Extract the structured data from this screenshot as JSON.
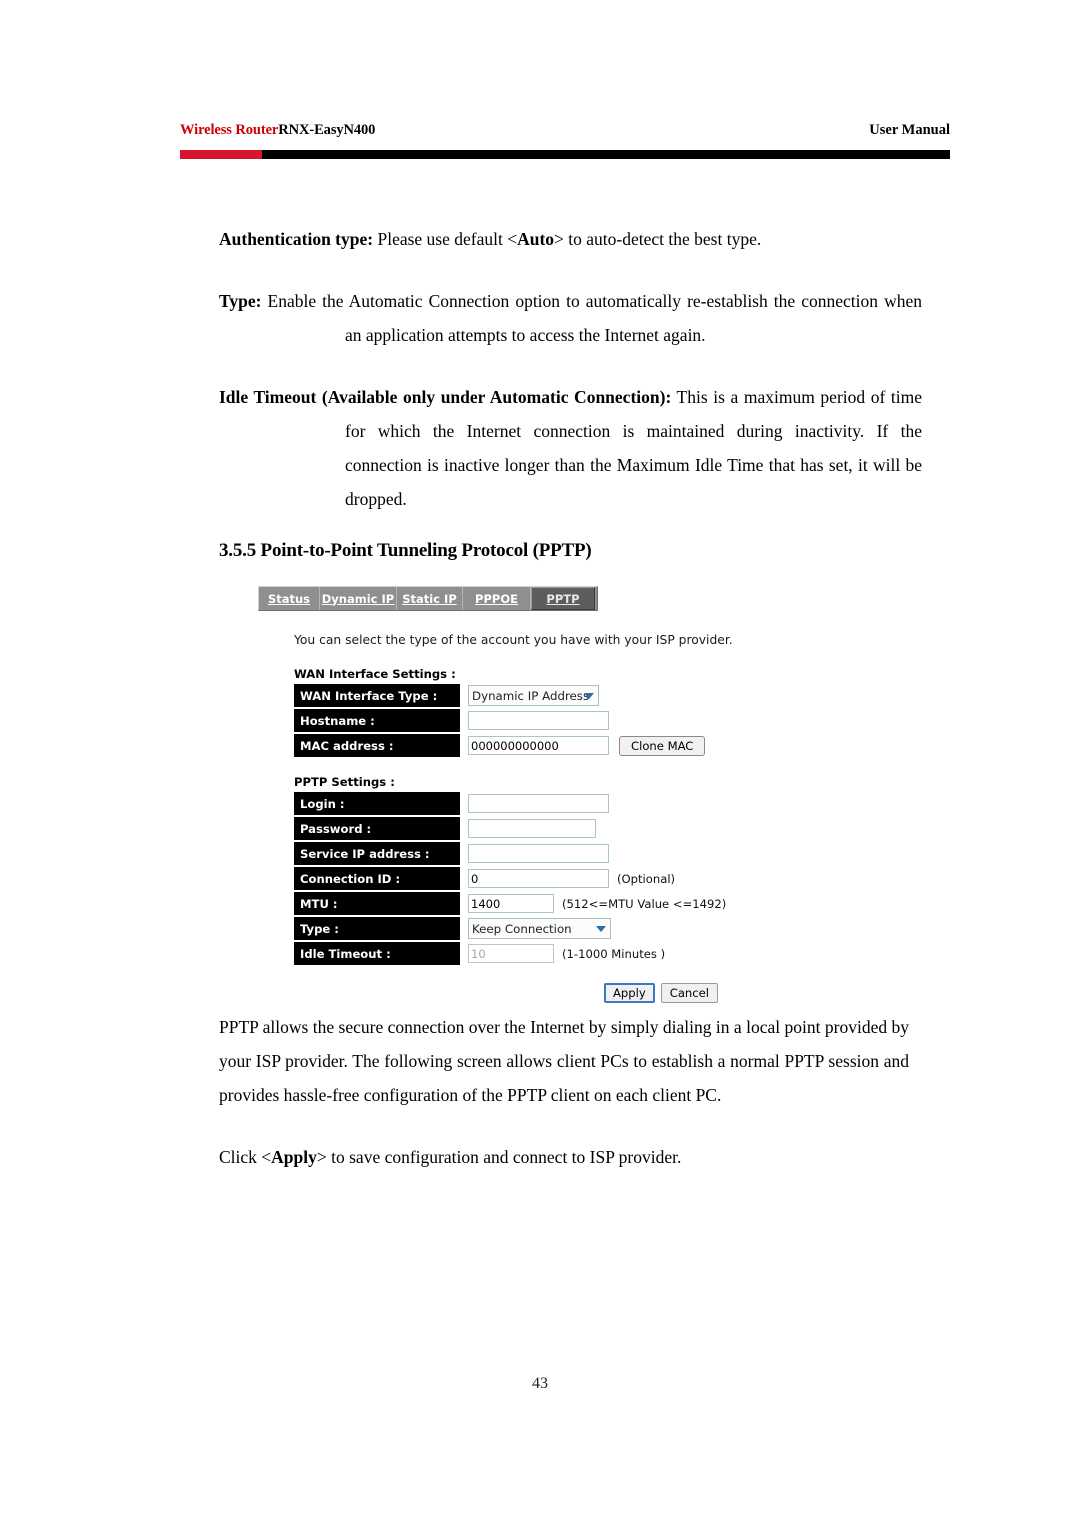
{
  "header": {
    "brand": "Wireless Router",
    "model": "RNX-EasyN400",
    "doc_type": "User Manual",
    "rule_red": "#d6142f",
    "rule_black": "#000000"
  },
  "body": {
    "para_auth_label": "Authentication type:",
    "para_auth_text_1": " Please use default <",
    "para_auth_bold": "Auto",
    "para_auth_text_2": "> to auto-detect the best type.",
    "para_type_label": "Type:",
    "para_type_text": "  Enable the Automatic Connection option to automatically re-establish the connection when an application attempts to access the Internet again.",
    "para_idle_label": "Idle Timeout (Available only under Automatic Connection):",
    "para_idle_text": " This is a maximum period of time for which the Internet connection is maintained during inactivity. If the connection is inactive longer than the Maximum Idle Time that has set, it will be dropped.",
    "section_title": "3.5.5 Point-to-Point Tunneling Protocol (PPTP)",
    "para_pptp_desc": "PPTP allows the secure connection over the Internet by simply dialing in a local point provided by your ISP provider. The following screen allows client PCs to establish a normal PPTP session and provides hassle-free configuration of the PPTP client on each client PC.",
    "para_click_pre": "Click <",
    "para_click_bold": "Apply",
    "para_click_post": "> to save configuration and connect to ISP provider."
  },
  "router_ui": {
    "tabs": [
      {
        "label": "Status",
        "active": false
      },
      {
        "label": "Dynamic IP",
        "active": false
      },
      {
        "label": "Static IP",
        "active": false
      },
      {
        "label": "PPPOE",
        "active": false
      },
      {
        "label": "PPTP",
        "active": true
      }
    ],
    "intro": "You can select the type of the account you have with your ISP provider.",
    "groups": [
      {
        "title": "WAN Interface Settings :",
        "rows": [
          {
            "label": "WAN Interface Type :",
            "control": "select",
            "value": "Dynamic IP Address",
            "hint": ""
          },
          {
            "label": "Hostname :",
            "control": "text",
            "value": "",
            "hint": ""
          },
          {
            "label": "MAC address :",
            "control": "text",
            "value": "000000000000",
            "hint": "",
            "button": "Clone MAC"
          }
        ]
      },
      {
        "title": "PPTP Settings :",
        "rows": [
          {
            "label": "Login :",
            "control": "text",
            "value": "",
            "hint": ""
          },
          {
            "label": "Password :",
            "control": "text",
            "value": "",
            "hint": ""
          },
          {
            "label": "Service IP address :",
            "control": "text",
            "value": "",
            "hint": ""
          },
          {
            "label": "Connection ID :",
            "control": "text",
            "value": "0",
            "hint": "(Optional)"
          },
          {
            "label": "MTU :",
            "control": "text",
            "value": "1400",
            "hint": "(512<=MTU Value <=1492)"
          },
          {
            "label": "Type :",
            "control": "select",
            "value": "Keep Connection",
            "hint": ""
          },
          {
            "label": "Idle Timeout :",
            "control": "text",
            "value": "10",
            "hint": "(1-1000 Minutes )",
            "disabled": true
          }
        ]
      }
    ],
    "buttons": {
      "apply": "Apply",
      "cancel": "Cancel"
    }
  },
  "footer": {
    "page_number": "43"
  }
}
